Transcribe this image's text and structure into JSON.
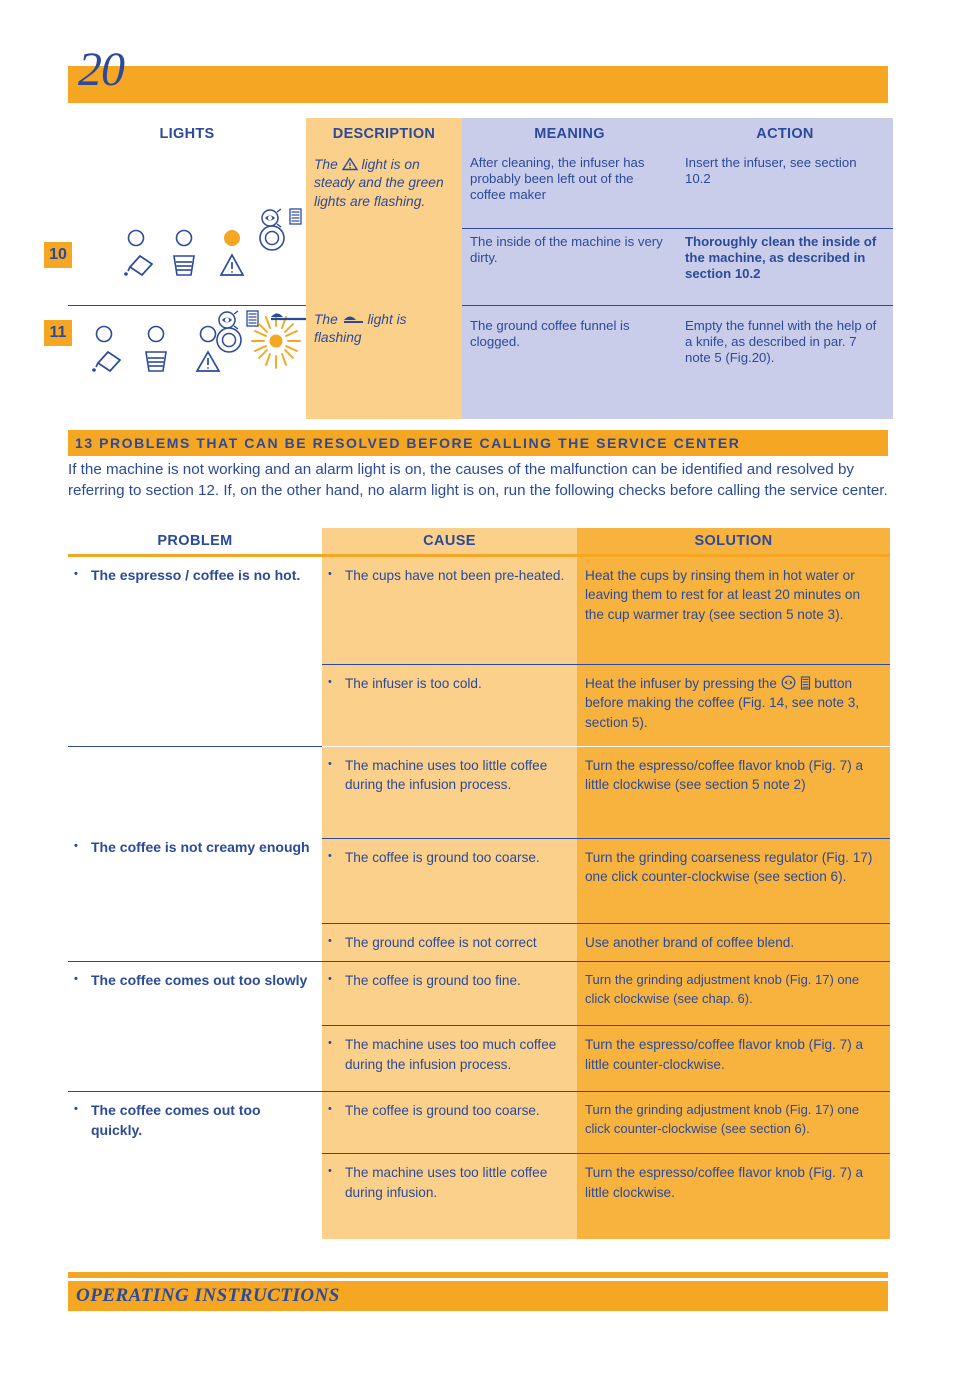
{
  "page": {
    "number": "20",
    "footer_label": "OPERATING INSTRUCTIONS"
  },
  "colors": {
    "brand_orange": "#f5a623",
    "light_orange": "#fbd08a",
    "mid_orange": "#f8b33f",
    "lavender": "#c9cde9",
    "blue_text": "#2b4a9b"
  },
  "lights_table": {
    "headers": {
      "lights": "LIGHTS",
      "description": "DESCRIPTION",
      "meaning": "MEANING",
      "action": "ACTION"
    },
    "rows": [
      {
        "number": "10",
        "lights_icons": [
          "water-tank-empty-icon",
          "grounds-container-icon",
          "warning-triangle-icon-lit",
          "steam-ready-icon"
        ],
        "description": "The ⚠ light is on steady and the green lights are flashing.",
        "description_parts": {
          "before": "The",
          "icon": "warning-triangle-icon",
          "after": "light is on steady and the green lights are flashing."
        },
        "subrows": [
          {
            "meaning": "After cleaning, the infuser has probably been left out of the coffee maker",
            "action": "Insert the infuser, see section 10.2",
            "action_bold": false
          },
          {
            "meaning": "The inside of the machine is very dirty.",
            "action": "Thoroughly clean the inside of the machine, as described in section 10.2",
            "action_bold": true
          }
        ]
      },
      {
        "number": "11",
        "lights_icons": [
          "water-tank-empty-icon",
          "grounds-container-icon",
          "warning-triangle-icon",
          "steam-ready-icon",
          "ground-coffee-funnel-icon-flashing"
        ],
        "description_parts": {
          "before": "The",
          "icon": "ground-coffee-funnel-icon",
          "after": "light is flashing"
        },
        "subrows": [
          {
            "meaning": "The ground coffee funnel is clogged.",
            "action": "Empty the funnel with the help of a knife, as described in par. 7 note 5 (Fig.20).",
            "action_bold": false
          }
        ]
      }
    ]
  },
  "section13": {
    "heading": "13 PROBLEMS THAT CAN BE RESOLVED BEFORE CALLING THE SERVICE CENTER",
    "intro": "If the machine is not working and an alarm light is on, the causes of the malfunction can be identified and resolved by referring to section 12. If, on the other hand, no alarm light is on, run the following checks before calling the service center."
  },
  "problems_table": {
    "headers": {
      "problem": "PROBLEM",
      "cause": "CAUSE",
      "solution": "SOLUTION"
    },
    "groups": [
      {
        "problem": "The espresso / coffee is no hot.",
        "rows": [
          {
            "cause": "The cups have not been pre-heated.",
            "solution": "Heat the cups by rinsing them in hot water or leaving them to rest for at least 20 minutes on the cup warmer tray  (see section 5 note 3)."
          },
          {
            "cause": "The infuser is too cold.",
            "solution_before": "Heat the infuser by pressing the",
            "solution_icon": "steam-button-icon",
            "solution_after": "button before making the coffee (Fig. 14, see note 3, section 5)."
          }
        ]
      },
      {
        "problem": "The coffee is not creamy enough",
        "rows": [
          {
            "cause": "The machine uses too little coffee during the infusion process.",
            "solution": "Turn the espresso/coffee flavor knob (Fig. 7) a little clockwise (see section 5 note 2)"
          },
          {
            "cause": "The coffee is ground too coarse.",
            "solution": "Turn the grinding coarseness regulator (Fig. 17) one click counter-clockwise (see section 6)."
          },
          {
            "cause": "The ground coffee is not correct",
            "solution": "Use another brand of coffee blend."
          }
        ]
      },
      {
        "problem": "The coffee comes out too slowly",
        "rows": [
          {
            "cause": "The coffee is ground too fine.",
            "solution": "Turn the grinding adjustment knob (Fig. 17) one click clockwise (see chap. 6)."
          },
          {
            "cause": "The machine uses too much coffee during the infusion process.",
            "solution": "Turn the espresso/coffee flavor knob (Fig. 7) a little counter-clockwise."
          }
        ]
      },
      {
        "problem": "The coffee comes out too quickly.",
        "rows": [
          {
            "cause": "The coffee is ground too coarse.",
            "solution": "Turn the grinding adjustment knob (Fig. 17) one click counter-clockwise (see section 6)."
          },
          {
            "cause": "The machine uses too little coffee during infusion.",
            "solution": "Turn the espresso/coffee flavor knob (Fig. 7) a little clockwise."
          }
        ]
      }
    ]
  },
  "bullet_glyph": "•"
}
